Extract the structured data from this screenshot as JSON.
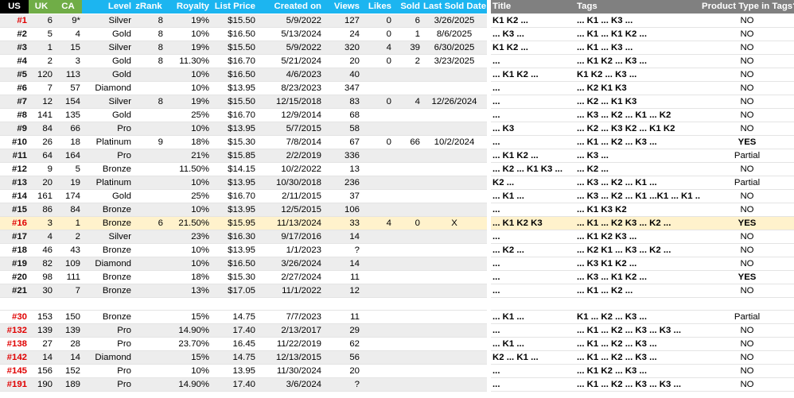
{
  "colors": {
    "us_header": "#000000",
    "ca_uk_header": "#70ad47",
    "blue_header": "#1cb5f0",
    "gray_header": "#808080",
    "highlight": "#fff2cc",
    "red_id": "#e00000"
  },
  "left_headers": [
    "US",
    "UK",
    "CA",
    "Level",
    "zRank",
    "Royalty",
    "List Price",
    "Created on",
    "Views",
    "Likes",
    "Sold",
    "Last Sold Date"
  ],
  "right_headers": [
    "Title",
    "Tags",
    "Product Type in Tags?"
  ],
  "rows": [
    {
      "us": "#1",
      "red": true,
      "uk": "6",
      "ca": "9*",
      "level": "Silver",
      "zrank": "8",
      "royalty": "19%",
      "price": "$15.50",
      "created": "5/9/2022",
      "views": "127",
      "likes": "0",
      "sold": "6",
      "last": "3/26/2025",
      "title": "K1 K2 ...",
      "tags": "... K1 ... K3 ...",
      "pt": "NO"
    },
    {
      "us": "#2",
      "red": false,
      "uk": "5",
      "ca": "4",
      "level": "Gold",
      "zrank": "8",
      "royalty": "10%",
      "price": "$16.50",
      "created": "5/13/2024",
      "views": "24",
      "likes": "0",
      "sold": "1",
      "last": "8/6/2025",
      "title": "... K3 ...",
      "tags": "... K1 ... K1 K2 ...",
      "pt": "NO"
    },
    {
      "us": "#3",
      "red": false,
      "uk": "1",
      "ca": "15",
      "level": "Silver",
      "zrank": "8",
      "royalty": "19%",
      "price": "$15.50",
      "created": "5/9/2022",
      "views": "320",
      "likes": "4",
      "sold": "39",
      "last": "6/30/2025",
      "title": "K1 K2 ...",
      "tags": "... K1 ... K3 ...",
      "pt": "NO"
    },
    {
      "us": "#4",
      "red": false,
      "uk": "2",
      "ca": "3",
      "level": "Gold",
      "zrank": "8",
      "royalty": "11.30%",
      "price": "$16.70",
      "created": "5/21/2024",
      "views": "20",
      "likes": "0",
      "sold": "2",
      "last": "3/23/2025",
      "title": "...",
      "tags": "... K1 K2 ... K3 ...",
      "pt": "NO"
    },
    {
      "us": "#5",
      "red": false,
      "uk": "120",
      "ca": "113",
      "level": "Gold",
      "zrank": "",
      "royalty": "10%",
      "price": "$16.50",
      "created": "4/6/2023",
      "views": "40",
      "likes": "",
      "sold": "",
      "last": "",
      "title": "... K1 K2 ...",
      "tags": "K1 K2 ... K3 ...",
      "pt": "NO"
    },
    {
      "us": "#6",
      "red": false,
      "uk": "7",
      "ca": "57",
      "level": "Diamond",
      "zrank": "",
      "royalty": "10%",
      "price": "$13.95",
      "created": "8/23/2023",
      "views": "347",
      "likes": "",
      "sold": "",
      "last": "",
      "title": "...",
      "tags": "... K2 K1 K3",
      "pt": "NO"
    },
    {
      "us": "#7",
      "red": false,
      "uk": "12",
      "ca": "154",
      "level": "Silver",
      "zrank": "8",
      "royalty": "19%",
      "price": "$15.50",
      "created": "12/15/2018",
      "views": "83",
      "likes": "0",
      "sold": "4",
      "last": "12/26/2024",
      "title": "...",
      "tags": "... K2 ... K1 K3",
      "pt": "NO"
    },
    {
      "us": "#8",
      "red": false,
      "uk": "141",
      "ca": "135",
      "level": "Gold",
      "zrank": "",
      "royalty": "25%",
      "price": "$16.70",
      "created": "12/9/2014",
      "views": "68",
      "likes": "",
      "sold": "",
      "last": "",
      "title": "...",
      "tags": "... K3 ... K2 ... K1 ... K2",
      "pt": "NO"
    },
    {
      "us": "#9",
      "red": false,
      "uk": "84",
      "ca": "66",
      "level": "Pro",
      "zrank": "",
      "royalty": "10%",
      "price": "$13.95",
      "created": "5/7/2015",
      "views": "58",
      "likes": "",
      "sold": "",
      "last": "",
      "title": "... K3",
      "tags": "... K2 ... K3 K2 ... K1 K2",
      "pt": "NO"
    },
    {
      "us": "#10",
      "red": false,
      "uk": "26",
      "ca": "18",
      "level": "Platinum",
      "zrank": "9",
      "royalty": "18%",
      "price": "$15.30",
      "created": "7/8/2014",
      "views": "67",
      "likes": "0",
      "sold": "66",
      "last": "10/2/2024",
      "title": "...",
      "tags": "... K1 ... K2 ... K3 ...",
      "pt": "YES"
    },
    {
      "us": "#11",
      "red": false,
      "uk": "64",
      "ca": "164",
      "level": "Pro",
      "zrank": "",
      "royalty": "21%",
      "price": "$15.85",
      "created": "2/2/2019",
      "views": "336",
      "likes": "",
      "sold": "",
      "last": "",
      "title": "... K1 K2 ...",
      "tags": "... K3 ...",
      "pt": "Partial"
    },
    {
      "us": "#12",
      "red": false,
      "uk": "9",
      "ca": "5",
      "level": "Bronze",
      "zrank": "",
      "royalty": "11.50%",
      "price": "$14.15",
      "created": "10/2/2022",
      "views": "13",
      "likes": "",
      "sold": "",
      "last": "",
      "title": "... K2 ... K1 K3 ...",
      "tags": "... K2 ...",
      "pt": "NO"
    },
    {
      "us": "#13",
      "red": false,
      "uk": "20",
      "ca": "19",
      "level": "Platinum",
      "zrank": "",
      "royalty": "10%",
      "price": "$13.95",
      "created": "10/30/2018",
      "views": "236",
      "likes": "",
      "sold": "",
      "last": "",
      "title": "K2 ...",
      "tags": "... K3 ... K2 ... K1 ...",
      "pt": "Partial"
    },
    {
      "us": "#14",
      "red": false,
      "uk": "161",
      "ca": "174",
      "level": "Gold",
      "zrank": "",
      "royalty": "25%",
      "price": "$16.70",
      "created": "2/11/2015",
      "views": "37",
      "likes": "",
      "sold": "",
      "last": "",
      "title": "... K1 ...",
      "tags": "... K3 ... K2 ... K1 ...K1 ... K1 ...",
      "pt": "NO"
    },
    {
      "us": "#15",
      "red": false,
      "uk": "86",
      "ca": "84",
      "level": "Bronze",
      "zrank": "",
      "royalty": "10%",
      "price": "$13.95",
      "created": "12/5/2015",
      "views": "106",
      "likes": "",
      "sold": "",
      "last": "",
      "title": "...",
      "tags": "... K1 K3 K2",
      "pt": "NO"
    },
    {
      "us": "#16",
      "red": true,
      "hl": true,
      "uk": "3",
      "ca": "1",
      "level": "Bronze",
      "zrank": "6",
      "royalty": "21.50%",
      "price": "$15.95",
      "created": "11/13/2024",
      "views": "33",
      "likes": "4",
      "sold": "0",
      "last": "X",
      "title": "... K1 K2 K3",
      "tags": "... K1 ... K2 K3 ... K2 ...",
      "pt": "YES"
    },
    {
      "us": "#17",
      "red": false,
      "uk": "4",
      "ca": "2",
      "level": "Silver",
      "zrank": "",
      "royalty": "23%",
      "price": "$16.30",
      "created": "9/17/2016",
      "views": "14",
      "likes": "",
      "sold": "",
      "last": "",
      "title": "...",
      "tags": "... K1 K2 K3 ...",
      "pt": "NO"
    },
    {
      "us": "#18",
      "red": false,
      "uk": "46",
      "ca": "43",
      "level": "Bronze",
      "zrank": "",
      "royalty": "10%",
      "price": "$13.95",
      "created": "1/1/2023",
      "views": "?",
      "likes": "",
      "sold": "",
      "last": "",
      "title": "... K2 ...",
      "tags": "... K2 K1 ... K3 ... K2 ...",
      "pt": "NO"
    },
    {
      "us": "#19",
      "red": false,
      "uk": "82",
      "ca": "109",
      "level": "Diamond",
      "zrank": "",
      "royalty": "10%",
      "price": "$16.50",
      "created": "3/26/2024",
      "views": "14",
      "likes": "",
      "sold": "",
      "last": "",
      "title": "...",
      "tags": "... K3 K1 K2 ...",
      "pt": "NO"
    },
    {
      "us": "#20",
      "red": false,
      "uk": "98",
      "ca": "111",
      "level": "Bronze",
      "zrank": "",
      "royalty": "18%",
      "price": "$15.30",
      "created": "2/27/2024",
      "views": "11",
      "likes": "",
      "sold": "",
      "last": "",
      "title": "...",
      "tags": "... K3 ... K1 K2 ...",
      "pt": "YES"
    },
    {
      "us": "#21",
      "red": false,
      "uk": "30",
      "ca": "7",
      "level": "Bronze",
      "zrank": "",
      "royalty": "13%",
      "price": "$17.05",
      "created": "11/1/2022",
      "views": "12",
      "likes": "",
      "sold": "",
      "last": "",
      "title": "...",
      "tags": "... K1 ... K2 ...",
      "pt": "NO"
    },
    {
      "blank": true
    },
    {
      "us": "#30",
      "red": true,
      "uk": "153",
      "ca": "150",
      "level": "Bronze",
      "zrank": "",
      "royalty": "15%",
      "price": "14.75",
      "created": "7/7/2023",
      "views": "11",
      "likes": "",
      "sold": "",
      "last": "",
      "title": "... K1 ...",
      "tags": "K1 ... K2 ... K3 ...",
      "pt": "Partial"
    },
    {
      "us": "#132",
      "red": true,
      "uk": "139",
      "ca": "139",
      "level": "Pro",
      "zrank": "",
      "royalty": "14.90%",
      "price": "17.40",
      "created": "2/13/2017",
      "views": "29",
      "likes": "",
      "sold": "",
      "last": "",
      "title": "...",
      "tags": "... K1 ... K2 ... K3 ... K3 ...",
      "pt": "NO"
    },
    {
      "us": "#138",
      "red": true,
      "uk": "27",
      "ca": "28",
      "level": "Pro",
      "zrank": "",
      "royalty": "23.70%",
      "price": "16.45",
      "created": "11/22/2019",
      "views": "62",
      "likes": "",
      "sold": "",
      "last": "",
      "title": "... K1 ...",
      "tags": "... K1 ... K2 ... K3 ...",
      "pt": "NO"
    },
    {
      "us": "#142",
      "red": true,
      "uk": "14",
      "ca": "14",
      "level": "Diamond",
      "zrank": "",
      "royalty": "15%",
      "price": "14.75",
      "created": "12/13/2015",
      "views": "56",
      "likes": "",
      "sold": "",
      "last": "",
      "title": "K2 ... K1 ...",
      "tags": "... K1 ... K2 ... K3 ...",
      "pt": "NO"
    },
    {
      "us": "#145",
      "red": true,
      "uk": "156",
      "ca": "152",
      "level": "Pro",
      "zrank": "",
      "royalty": "10%",
      "price": "13.95",
      "created": "11/30/2024",
      "views": "20",
      "likes": "",
      "sold": "",
      "last": "",
      "title": "...",
      "tags": "... K1 K2 ... K3 ...",
      "pt": "NO"
    },
    {
      "us": "#191",
      "red": true,
      "uk": "190",
      "ca": "189",
      "level": "Pro",
      "zrank": "",
      "royalty": "14.90%",
      "price": "17.40",
      "created": "3/6/2024",
      "views": "?",
      "likes": "",
      "sold": "",
      "last": "",
      "title": "...",
      "tags": "... K1 ... K2 ... K3 ... K3 ...",
      "pt": "NO"
    }
  ]
}
